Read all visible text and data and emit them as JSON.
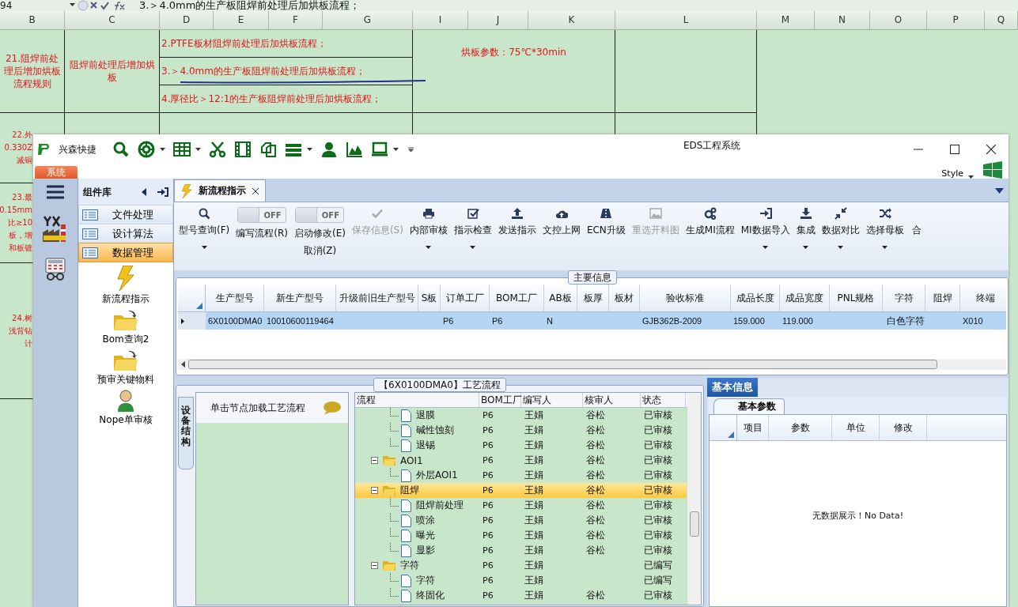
{
  "spreadsheet": {
    "name_box": "94",
    "formula": "3.＞4.0mm的生产板阻焊前处理后加烘板流程；",
    "columns": [
      "B",
      "C",
      "D",
      "E",
      "F",
      "G",
      "I",
      "J",
      "K",
      "L",
      "M",
      "N",
      "O",
      "P",
      "Q"
    ],
    "rule_row": {
      "rule": "21.阻焊前处理后增加烘板流程规则",
      "title": "阻焊前处理后增加烘板",
      "items": [
        "2.PTFE板材阻焊前处理后加烘板流程；",
        "3.＞4.0mm的生产板阻焊前处理后加烘板流程；",
        "4.厚径比＞12:1的生产板阻焊前处理后加烘板流程；"
      ],
      "parameters": "烘板参数：75℃*30min"
    },
    "partial_rows": [
      {
        "lines": [
          "22.外",
          "0.330Z",
          "减铜"
        ]
      },
      {
        "lines": [
          "23.最",
          "0.15mm",
          "比≥10",
          "板，增",
          "和板镀"
        ]
      },
      {
        "lines": [
          "24.树",
          "浅背钻",
          "计"
        ]
      }
    ]
  },
  "window": {
    "title": "EDS工程系统",
    "app_name": "兴森快捷",
    "ribbon_tab": "系统",
    "style_menu": "Style",
    "quick_access": [
      {
        "has_menu": false
      },
      {
        "has_menu": true
      },
      {
        "has_menu": true
      },
      {
        "has_menu": false
      },
      {
        "has_menu": false
      },
      {
        "has_menu": false
      },
      {
        "has_menu": true
      },
      {
        "has_menu": false
      },
      {
        "has_menu": false
      },
      {
        "has_menu": true
      }
    ]
  },
  "sidebar": {
    "title": "组件库",
    "groups": [
      {
        "label": "文件处理",
        "selected": false
      },
      {
        "label": "设计算法",
        "selected": false
      },
      {
        "label": "数据管理",
        "selected": true
      }
    ],
    "items": [
      {
        "label": "新流程指示"
      },
      {
        "label": "Bom查询2"
      },
      {
        "label": "预审关键物料"
      },
      {
        "label": "Nope单审核"
      }
    ]
  },
  "tabs": [
    {
      "label": "新流程指示",
      "selected": true
    }
  ],
  "toolbar": [
    {
      "kind": "button",
      "label": "型号查询(F)",
      "disabled": false,
      "has_menu": true
    },
    {
      "kind": "toggle",
      "label": "编写流程(R)",
      "state_text": "OFF",
      "on": false,
      "disabled": false,
      "has_menu": false
    },
    {
      "kind": "toggle",
      "label": "启动修改(E)",
      "sublabel": "取消(Z)",
      "state_text": "OFF",
      "on": false,
      "disabled": false,
      "has_menu": false
    },
    {
      "kind": "button",
      "label": "保存信息(S)",
      "disabled": true,
      "has_menu": false
    },
    {
      "kind": "button",
      "label": "内部审核",
      "disabled": false,
      "has_menu": true
    },
    {
      "kind": "button",
      "label": "指示检查",
      "disabled": false,
      "has_menu": true
    },
    {
      "kind": "button",
      "label": "发送指示",
      "disabled": false,
      "has_menu": false
    },
    {
      "kind": "button",
      "label": "文控上网",
      "disabled": false,
      "has_menu": false
    },
    {
      "kind": "button",
      "label": "ECN升级",
      "disabled": false,
      "has_menu": false
    },
    {
      "kind": "button",
      "label": "重选开料图",
      "disabled": true,
      "has_menu": false
    },
    {
      "kind": "button",
      "label": "生成MI流程",
      "disabled": false,
      "has_menu": false
    },
    {
      "kind": "button",
      "label": "MI数据导入",
      "disabled": false,
      "has_menu": true
    },
    {
      "kind": "button",
      "label": "集成",
      "disabled": false,
      "has_menu": true
    },
    {
      "kind": "button",
      "label": "数据对比",
      "disabled": false,
      "has_menu": true
    },
    {
      "kind": "button",
      "label": "选择母板",
      "disabled": false,
      "has_menu": true
    },
    {
      "kind": "button",
      "label": "合",
      "disabled": false,
      "has_menu": false
    }
  ],
  "main_info": {
    "title": "主要信息",
    "columns": [
      "生产型号",
      "新生产型号",
      "升级前旧生产型号",
      "S板",
      "订单工厂",
      "BOM工厂",
      "AB板",
      "板厚",
      "板材",
      "验收标准",
      "成品长度",
      "成品宽度",
      "PNL规格",
      "字符",
      "阻焊",
      "终端"
    ],
    "rows": [
      {
        "selected": true,
        "cells": [
          "6X0100DMA0",
          "10010600119464",
          null,
          null,
          "P6",
          "P6",
          "N",
          null,
          null,
          "GJB362B-2009",
          "159.000",
          "119.000",
          null,
          "白色字符",
          null,
          "X010"
        ]
      }
    ]
  },
  "process_flow": {
    "title": "【6X0100DMA0】工艺流程",
    "side_tab": "设备结构",
    "hint": "单击节点加载工艺流程",
    "columns": [
      "流程",
      "BOM工厂",
      "编写人",
      "核审人",
      "状态"
    ],
    "nodes": [
      {
        "kind": "step",
        "name": "退膜",
        "bom": "P6",
        "writer": "王娟",
        "reviewer": "谷松",
        "status": "已审核",
        "selected": false
      },
      {
        "kind": "step",
        "name": "碱性蚀刻",
        "bom": "P6",
        "writer": "王娟",
        "reviewer": "谷松",
        "status": "已审核",
        "selected": false
      },
      {
        "kind": "step",
        "name": "退锡",
        "bom": "P6",
        "writer": "王娟",
        "reviewer": "谷松",
        "status": "已审核",
        "selected": false
      },
      {
        "kind": "group",
        "name": "AOI1",
        "bom": "P6",
        "writer": "王娟",
        "reviewer": "谷松",
        "status": "已审核",
        "selected": false,
        "expanded": true,
        "children": [
          {
            "kind": "step",
            "name": "外层AOI1",
            "bom": "P6",
            "writer": "王娟",
            "reviewer": "谷松",
            "status": "已审核",
            "selected": false
          }
        ]
      },
      {
        "kind": "group",
        "name": "阻焊",
        "bom": "P6",
        "writer": "王娟",
        "reviewer": "谷松",
        "status": "已审核",
        "selected": true,
        "expanded": true,
        "children": [
          {
            "kind": "step",
            "name": "阻焊前处理",
            "bom": "P6",
            "writer": "王娟",
            "reviewer": "谷松",
            "status": "已审核",
            "selected": false
          },
          {
            "kind": "step",
            "name": "喷涂",
            "bom": "P6",
            "writer": "王娟",
            "reviewer": "谷松",
            "status": "已审核",
            "selected": false
          },
          {
            "kind": "step",
            "name": "曝光",
            "bom": "P6",
            "writer": "王娟",
            "reviewer": "谷松",
            "status": "已审核",
            "selected": false
          },
          {
            "kind": "step",
            "name": "显影",
            "bom": "P6",
            "writer": "王娟",
            "reviewer": "谷松",
            "status": "已审核",
            "selected": false
          }
        ]
      },
      {
        "kind": "group",
        "name": "字符",
        "bom": "P6",
        "writer": "王娟",
        "status": "已编写",
        "selected": false,
        "expanded": true,
        "children": [
          {
            "kind": "step",
            "name": "字符",
            "bom": "P6",
            "writer": "王娟",
            "status": "已编写",
            "selected": false
          },
          {
            "kind": "step",
            "name": "终固化",
            "bom": "P6",
            "writer": "王娟",
            "reviewer": "谷松",
            "status": "已审核",
            "selected": false
          }
        ]
      }
    ]
  },
  "basic_info": {
    "tab": "基本信息",
    "subtab": "基本参数",
    "columns": [
      "项目",
      "参数",
      "单位",
      "修改"
    ],
    "empty_text": "无数据展示！No Data!"
  }
}
